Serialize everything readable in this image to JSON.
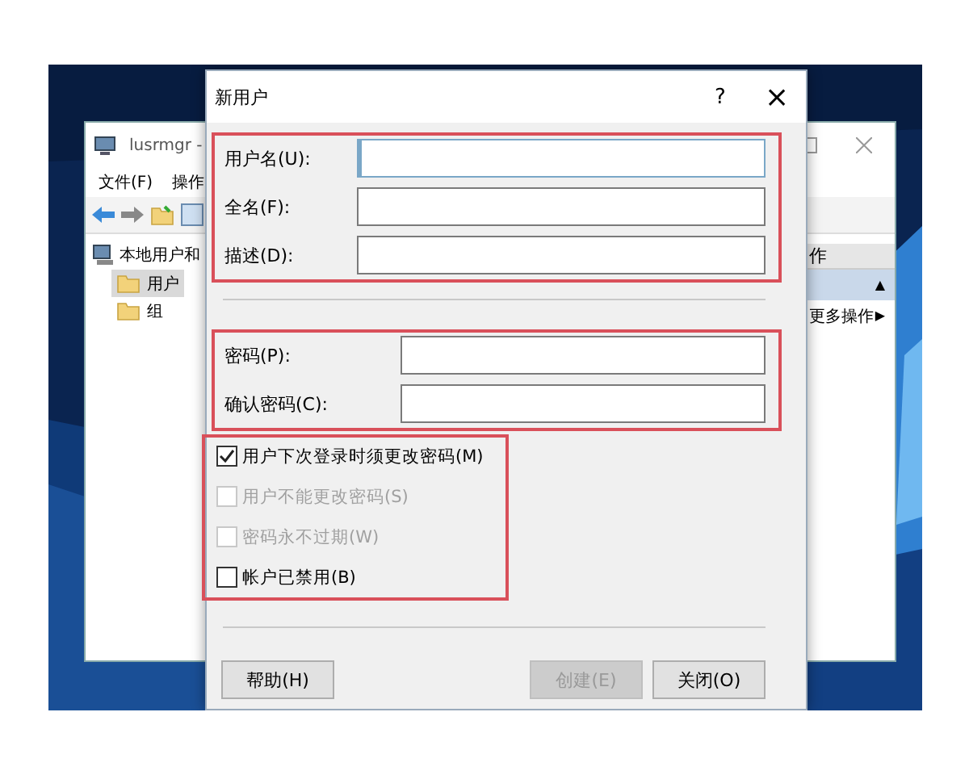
{
  "background_window": {
    "title": "lusrmgr -",
    "menu": [
      "文件(F)",
      "操作"
    ],
    "tree": [
      {
        "label": "本地用户和",
        "children": [
          {
            "label": "用户",
            "selected": true
          },
          {
            "label": "组",
            "selected": false
          }
        ]
      }
    ],
    "actions_header": "作",
    "actions": [
      {
        "kind": "section",
        "icon": "▲",
        "selected": true
      },
      {
        "kind": "item",
        "label": "更多操作",
        "icon": "▶",
        "selected": false
      }
    ]
  },
  "dialog": {
    "title": "新用户",
    "help": "?",
    "close": "×",
    "groups": [
      {
        "highlighted": true,
        "fields": [
          {
            "label": "用户名(U):",
            "focused": true
          },
          {
            "label": "全名(F):",
            "focused": false
          },
          {
            "label": "描述(D):",
            "focused": false
          }
        ]
      },
      {
        "highlighted": true,
        "fields": [
          {
            "label": "密码(P):",
            "focused": false
          },
          {
            "label": "确认密码(C):",
            "focused": false
          }
        ]
      }
    ],
    "options_highlighted": true,
    "options": [
      {
        "label": "用户下次登录时须更改密码(M)",
        "checked": true,
        "disabled": false
      },
      {
        "label": "用户不能更改密码(S)",
        "checked": false,
        "disabled": true
      },
      {
        "label": "密码永不过期(W)",
        "checked": false,
        "disabled": true
      },
      {
        "label": "帐户已禁用(B)",
        "checked": false,
        "disabled": false
      }
    ],
    "buttons": [
      {
        "label": "帮助(H)",
        "disabled": false
      },
      {
        "label": "创建(E)",
        "disabled": true
      },
      {
        "label": "关闭(O)",
        "disabled": false
      }
    ]
  }
}
